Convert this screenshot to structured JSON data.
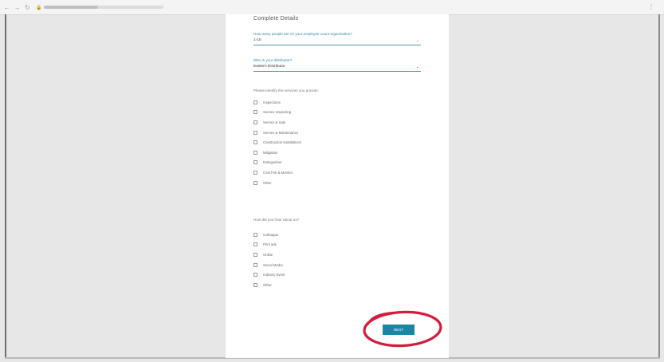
{
  "browser": {
    "address_icon": "lock-icon",
    "url": "",
    "menu_icon": "more-vert-icon"
  },
  "form": {
    "title": "Complete Details",
    "q1": {
      "label": "How many people are on your employee count organization?",
      "value": "1-10"
    },
    "q2": {
      "label": "Who is your distributor?",
      "value": "Eastern Distributor"
    },
    "services": {
      "label": "Please identify the services you provide:",
      "options": [
        "Inspections",
        "Service Inspecting",
        "Service & Sale",
        "Service & Maintenance",
        "Construction Installations",
        "Mitigation",
        "Extinguisher",
        "Cost Fire & Monitor",
        "Other"
      ]
    },
    "source": {
      "label": "How did you hear about us?",
      "options": [
        "Colleague",
        "Print ads",
        "Online",
        "Social Media",
        "Industry Event",
        "Other"
      ]
    },
    "next_label": "NEXT"
  },
  "colors": {
    "accent": "#1a86a6",
    "annotation": "#d41c3c"
  }
}
